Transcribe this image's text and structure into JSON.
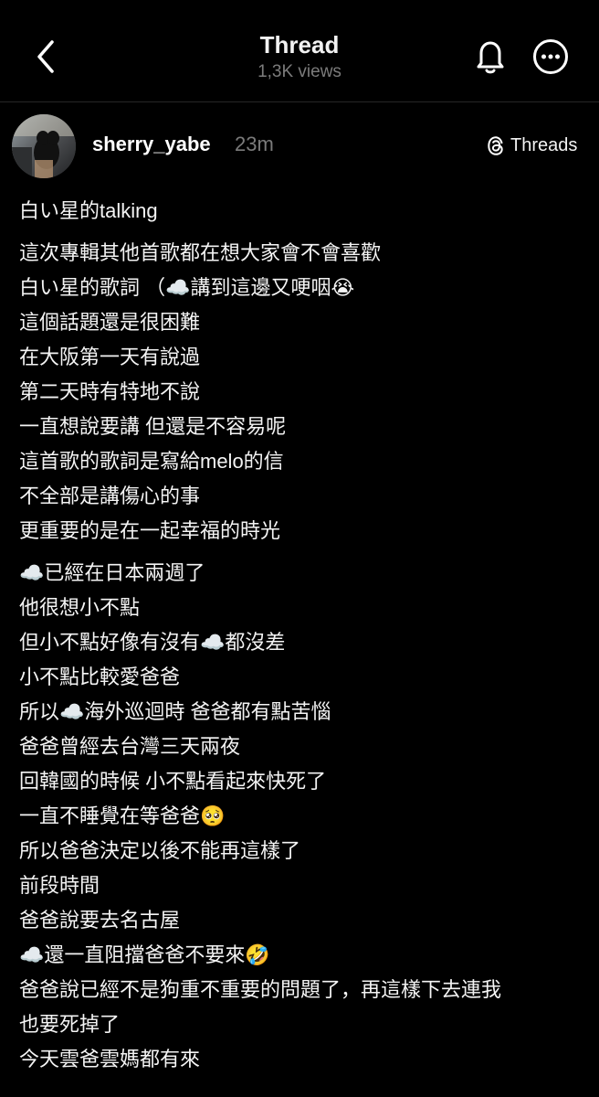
{
  "header": {
    "title": "Thread",
    "views": "1,3K views"
  },
  "post": {
    "username": "sherry_yabe",
    "time": "23m",
    "threads_label": "Threads",
    "paragraphs": [
      [
        "白い星的talking"
      ],
      [
        "這次專輯其他首歌都在想大家會不會喜歡",
        "白い星的歌詞 （☁️講到這邊又哽咽😭",
        "這個話題還是很困難",
        "在大阪第一天有說過",
        "第二天時有特地不說",
        "一直想說要講 但還是不容易呢",
        "這首歌的歌詞是寫給melo的信",
        "不全部是講傷心的事",
        "更重要的是在一起幸福的時光"
      ],
      [
        "☁️已經在日本兩週了",
        "他很想小不點",
        "但小不點好像有沒有☁️都沒差",
        "小不點比較愛爸爸",
        "所以☁️海外巡迴時 爸爸都有點苦惱",
        "爸爸曾經去台灣三天兩夜",
        "回韓國的時候 小不點看起來快死了",
        "一直不睡覺在等爸爸🥺",
        "所以爸爸決定以後不能再這樣了",
        "前段時間",
        "爸爸說要去名古屋",
        "☁️還一直阻擋爸爸不要來🤣",
        "爸爸說已經不是狗重不重要的問題了，再這樣下去連我",
        "也要死掉了",
        "今天雲爸雲媽都有來"
      ]
    ]
  },
  "icons": {
    "back": "chevron-left-icon",
    "bell": "bell-icon",
    "more": "more-icon",
    "threads": "threads-logo-icon"
  }
}
